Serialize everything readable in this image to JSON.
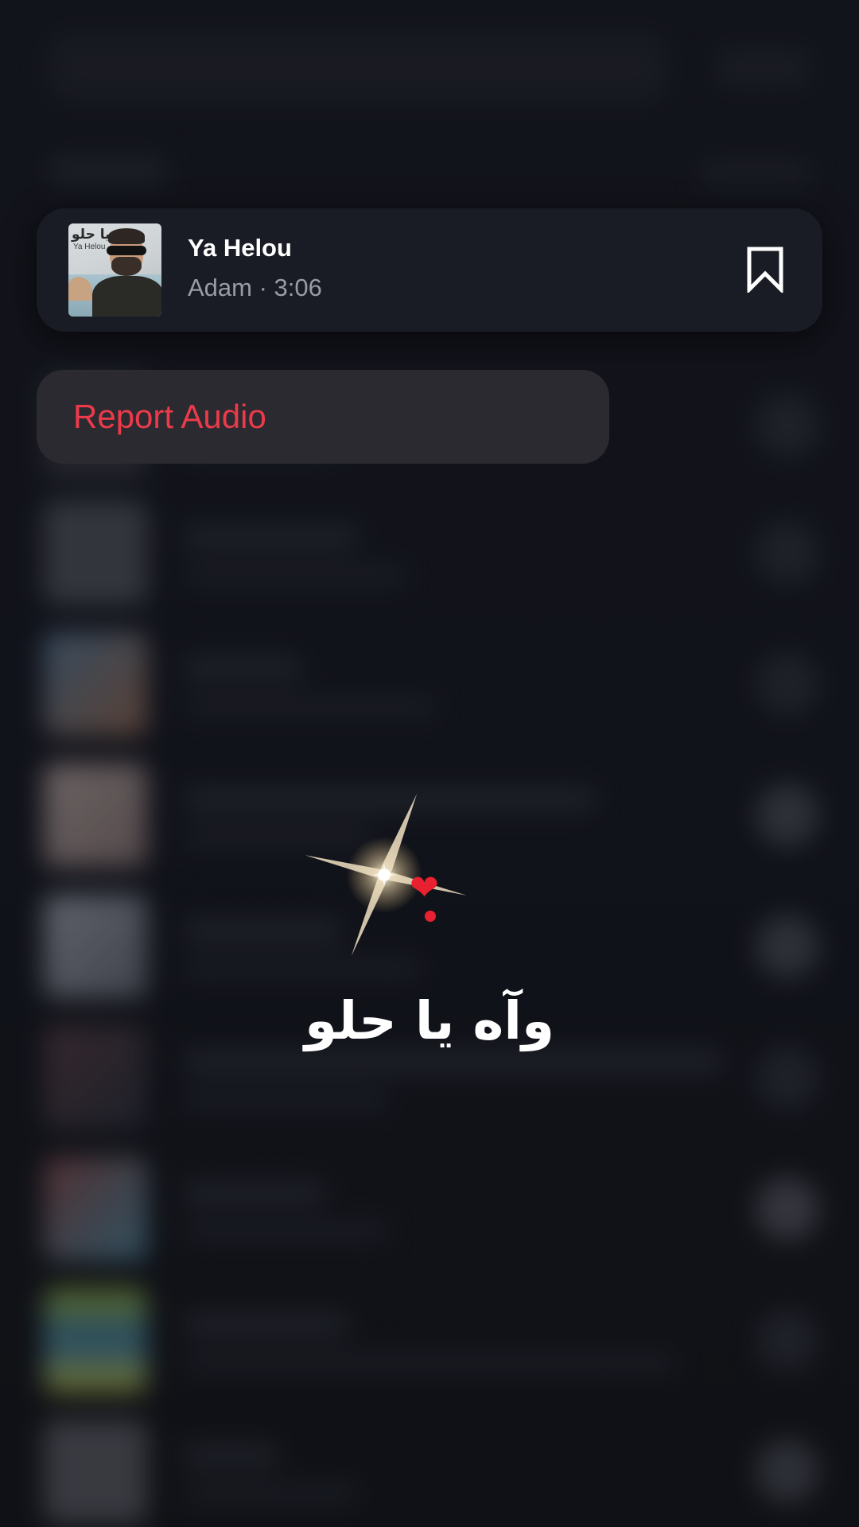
{
  "audio": {
    "cover_title_ar": "يا حلو",
    "cover_title_en": "Ya Helou",
    "title": "Ya Helou",
    "meta": "Adam · 3:06",
    "save_icon": "bookmark-icon"
  },
  "menu": {
    "items": [
      {
        "label": "Report Audio",
        "color": "#ec3a4a"
      }
    ]
  },
  "overlay": {
    "sparkle_icon": "sparkle-icon",
    "heart_icon": "heart-exclamation-icon",
    "caption": "وآه يا حلو"
  },
  "colors": {
    "background": "#15161d",
    "card": "#1a1c25",
    "menu": "#2a2a30",
    "danger": "#ec3a4a",
    "muted_text": "#9a9ba4"
  }
}
